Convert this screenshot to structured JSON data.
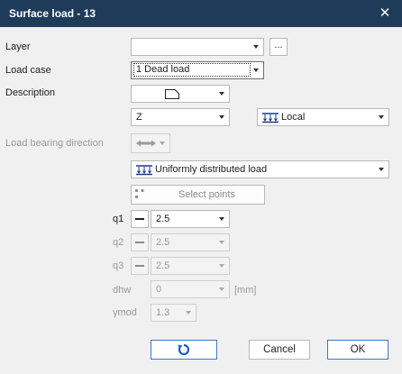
{
  "dialog": {
    "title": "Surface load - 13",
    "close_icon": "close-icon"
  },
  "labels": {
    "layer": "Layer",
    "load_case": "Load case",
    "description": "Description",
    "load_bearing_direction": "Load bearing direction",
    "q1": "q1",
    "q2": "q2",
    "q3": "q3",
    "dhw": "dhw",
    "ymod": "γmod"
  },
  "fields": {
    "layer_value": "",
    "browse_label": "...",
    "load_case_value": "1 Dead load",
    "direction_value": "Z",
    "system_value": "Local",
    "distribution_value": "Uniformly distributed load",
    "select_points_label": "Select points",
    "q1_value": "2.5",
    "q2_value": "2.5",
    "q3_value": "2.5",
    "dhw_value": "0",
    "dhw_unit": "[mm]",
    "ymod_value": "1.3"
  },
  "footer": {
    "cancel_label": "Cancel",
    "ok_label": "OK"
  },
  "colors": {
    "title_bar": "#1f3b5a",
    "accent": "#3a78c7",
    "load_icon": "#1a3a8a"
  }
}
